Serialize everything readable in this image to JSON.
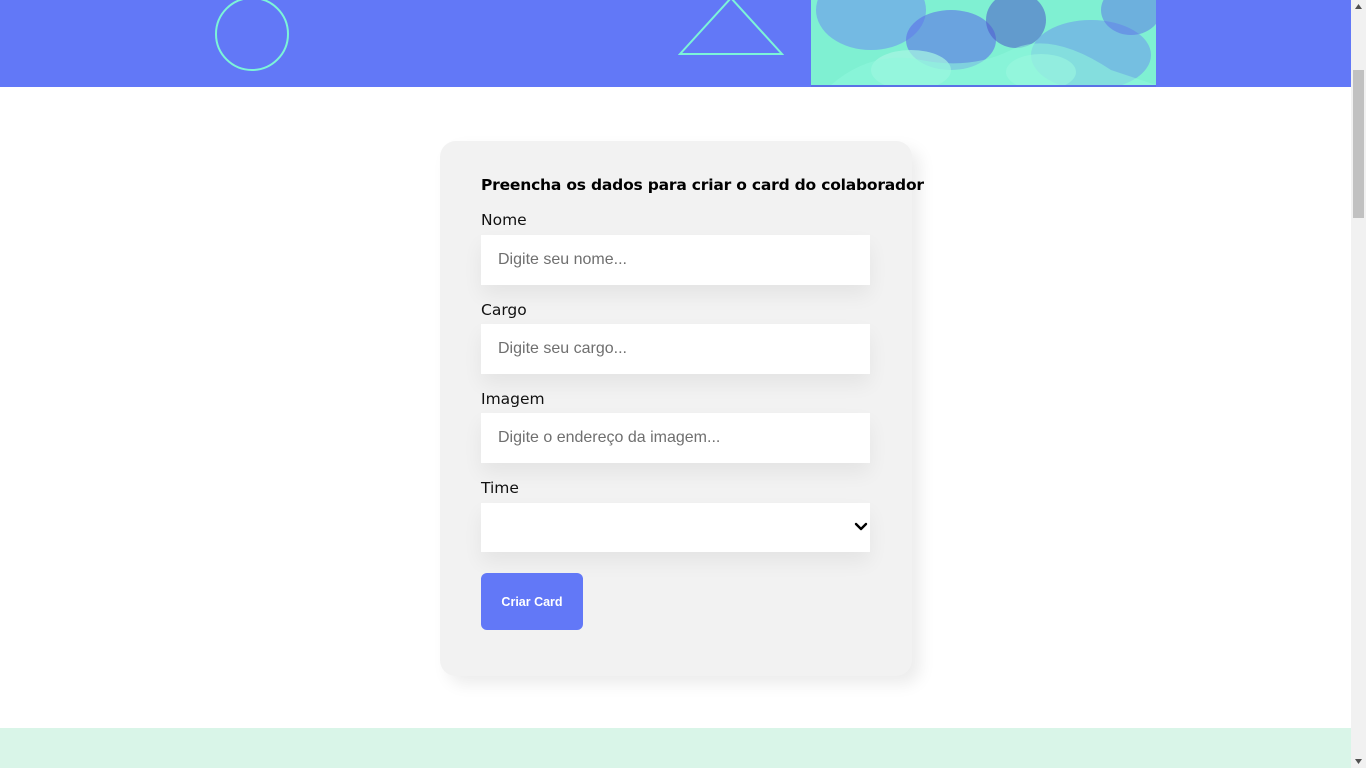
{
  "banner": {
    "image_icon": "team-hands-photo",
    "accent_color": "#6278f7",
    "shape_color": "#7cf4d8"
  },
  "form": {
    "title": "Preencha os dados para criar o card do colaborador",
    "fields": {
      "nome": {
        "label": "Nome",
        "placeholder": "Digite seu nome...",
        "value": ""
      },
      "cargo": {
        "label": "Cargo",
        "placeholder": "Digite seu cargo...",
        "value": ""
      },
      "imagem": {
        "label": "Imagem",
        "placeholder": "Digite o endereço da imagem...",
        "value": ""
      },
      "time": {
        "label": "Time",
        "selected": ""
      }
    },
    "submit_label": "Criar Card",
    "background_color": "#f2f2f2"
  },
  "footer": {
    "background_color": "#d9f5e8"
  }
}
